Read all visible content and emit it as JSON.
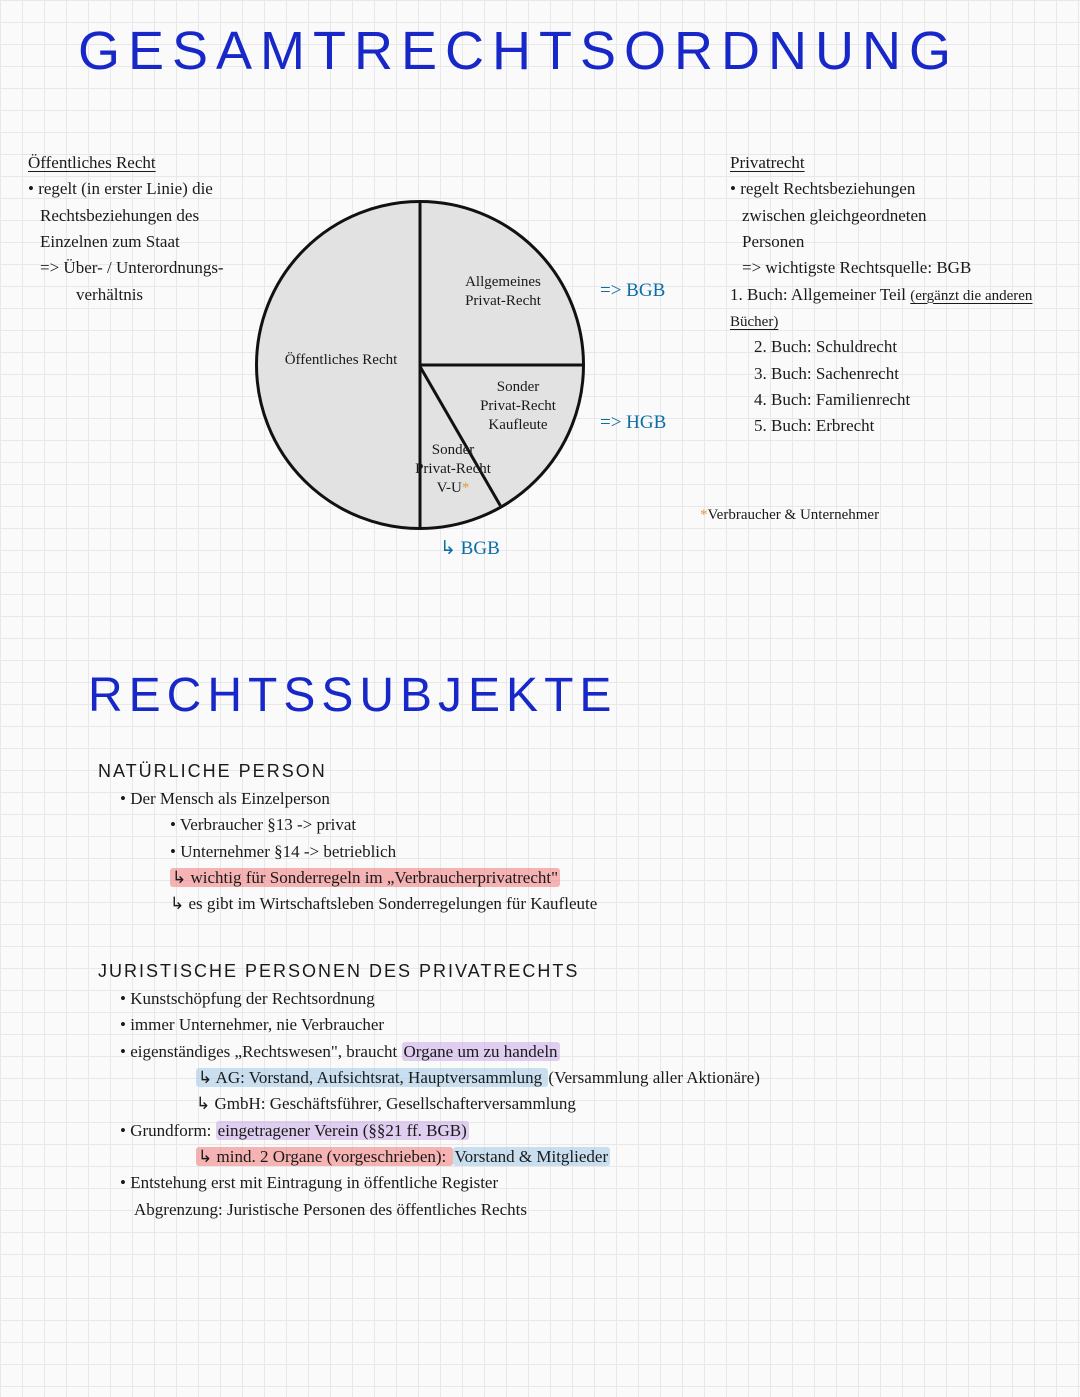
{
  "title_main": "GESAMTRECHTSORDNUNG",
  "title_sub": "RECHTSSUBJEKTE",
  "left": {
    "heading": "Öffentliches Recht",
    "l1": "• regelt (in erster Linie) die",
    "l2": "Rechtsbeziehungen des",
    "l3": "Einzelnen zum Staat",
    "l4": "=> Über- / Unterordnungs-",
    "l5": "verhältnis"
  },
  "right": {
    "heading": "Privatrecht",
    "l1": "• regelt Rechtsbeziehungen",
    "l2": "zwischen gleichgeordneten",
    "l3": "Personen",
    "l4": "=> wichtigste Rechtsquelle: BGB",
    "b1": "1. Buch: Allgemeiner Teil",
    "b1x": "(ergänzt die anderen Bücher)",
    "b2": "2. Buch: Schuldrecht",
    "b3": "3. Buch: Sachenrecht",
    "b4": "4. Buch: Familienrecht",
    "b5": "5. Buch: Erbrecht"
  },
  "pie": {
    "seg_public": "Öffentliches Recht",
    "seg_allg1": "Allgemeines",
    "seg_allg2": "Privat-Recht",
    "seg_sk1": "Sonder",
    "seg_sk2": "Privat-Recht",
    "seg_sk3": "Kaufleute",
    "seg_sv1": "Sonder",
    "seg_sv2": "Privat-Recht",
    "seg_sv3": "V-U",
    "arrow_bgb": "=> BGB",
    "arrow_hgb": "=> HGB",
    "arrow_bgb2": "↳ BGB",
    "footnote": "Verbraucher & Unternehmer"
  },
  "nat": {
    "heading": "NATÜRLICHE PERSON",
    "l1": "• Der Mensch als Einzelperson",
    "l2": "• Verbraucher §13 -> privat",
    "l3": "• Unternehmer §14 -> betrieblich",
    "l4": "↳ wichtig für Sonderregeln im „Verbraucherprivatrecht\"",
    "l5": "↳ es gibt im Wirtschaftsleben Sonderregelungen für Kaufleute"
  },
  "jur": {
    "heading": "JURISTISCHE PERSONEN DES PRIVATRECHTS",
    "l1": "• Kunstschöpfung der Rechtsordnung",
    "l2": "• immer Unternehmer, nie Verbraucher",
    "l3a": "• eigenständiges „Rechtswesen\", braucht ",
    "l3b": "Organe um zu handeln",
    "l4a": "↳ AG: Vorstand, Aufsichtsrat, Hauptversammlung ",
    "l4b": "(Versammlung aller Aktionäre)",
    "l5": "↳ GmbH: Geschäftsführer, Gesellschafterversammlung",
    "l6a": "• Grundform: ",
    "l6b": "eingetragener Verein (§§21 ff. BGB)",
    "l7a": "↳ mind. 2 Organe (vorgeschrieben): ",
    "l7b": "Vorstand & Mitglieder",
    "l8": "• Entstehung erst mit Eintragung in öffentliche Register",
    "l9": "Abgrenzung: Juristische Personen des öffentliches Rechts"
  },
  "chart_data": {
    "type": "pie",
    "title": "Gesamtrechtsordnung",
    "series": [
      {
        "name": "Öffentliches Recht",
        "value": 50,
        "note": ""
      },
      {
        "name": "Allgemeines Privat-Recht",
        "value": 25,
        "note": "BGB"
      },
      {
        "name": "Sonder Privat-Recht Kaufleute",
        "value": 16.7,
        "note": "HGB"
      },
      {
        "name": "Sonder Privat-Recht V-U",
        "value": 8.3,
        "note": "BGB"
      }
    ]
  }
}
